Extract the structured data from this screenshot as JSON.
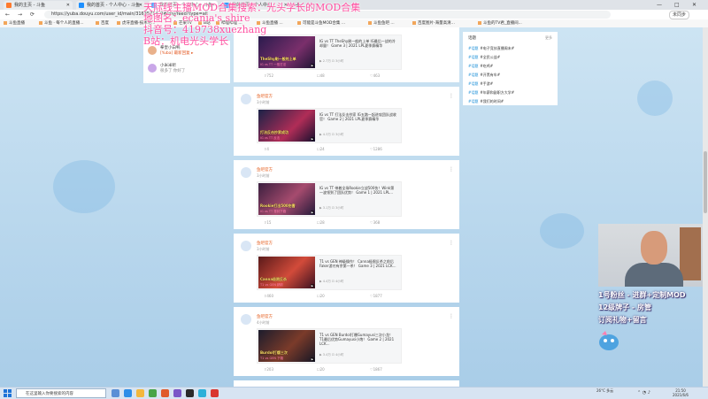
{
  "tabs": [
    {
      "label": "我的主页 - 斗鱼",
      "color": "#ff7a2e",
      "active": false
    },
    {
      "label": "我的首页 - 个人中心 - 斗鱼",
      "color": "#1e90ff",
      "active": false
    },
    {
      "label": "我的首页 - 个人中心 - 斗鱼",
      "color": "#1e90ff",
      "active": true
    },
    {
      "label": "我的首页 - 个人中心",
      "color": "#1e90ff",
      "active": false
    }
  ],
  "new_tab": "+",
  "window_controls": {
    "minimize": "—",
    "maximize": "□",
    "close": "✕"
  },
  "address": {
    "back": "←",
    "forward": "→",
    "refresh": "⟳",
    "url": "https://yuba.douyu.com/user_id/main/31635714_0#/my/feed?type=all",
    "profile_label": "未同步"
  },
  "bookmarks": [
    "斗鱼直播",
    "斗鱼 · 每个人的直播...",
    "百度",
    "虎牙直播-技术宅...",
    "芒果TV",
    "B站",
    "哔哩哔哩 ...",
    "斗鱼直播 ...",
    "可能是斗鱼MOD合集 ...",
    "斗鱼鱼吧 ...",
    "百度图片-海量高清...",
    "斗鱼的TV君_直播间..."
  ],
  "left_card": {
    "items": [
      {
        "name": "拳皇小白鸭",
        "sub": "[Yuba] 最新回复 ▸"
      },
      {
        "name": "小米米听",
        "sub": "很多了 你好了"
      }
    ]
  },
  "overlay": {
    "line1": "天际线主播MOD合集搜索：光头学长的MOD合集",
    "line2": "地图名：ecania's shire",
    "line3": "抖音号：419738xuezhang",
    "line4": "B站：机电光头学长"
  },
  "posts": [
    {
      "name": "",
      "time": "",
      "thumb_caption": "TheShy刷一般的上单",
      "thumb_caption2": "IG vs TT 一般打法",
      "title": "IG vs TT TheShy刷一般的上单 IG最后一战的冷却量！ Game 3 | 2021 LPL夏季赛精华",
      "stats": "▶ 2.7万  ⊡ 3小时",
      "likes": "752",
      "comments": "48",
      "shares": "463"
    },
    {
      "name": "鱼吧官方",
      "time": "3小时前",
      "thumb_caption": "打法反击抄家成功",
      "thumb_caption2": "IG vs TT 反击",
      "title": "IG vs TT 打法反击抄家 IG五路一起进攻团队战收官！ Game 2 | 2021 LPL夏季赛精华",
      "stats": "▶ 4.3万  ⊡ 3小时",
      "likes": "4",
      "comments": "24",
      "shares": "1286"
    },
    {
      "name": "鱼吧官方",
      "time": "3小时前",
      "thumb_caption": "Rookie打出500伤害",
      "thumb_caption2": "IG vs TT 零封下路",
      "title": "IG vs TT 带着全场Rookie立战500伤！Wink第一波领到了团队优势！ Game 1 | 2021 LPL...",
      "stats": "▶ 3.1万  ⊡ 3小时",
      "likes": "15",
      "comments": "28",
      "shares": "368"
    },
    {
      "name": "鱼吧官方",
      "time": "3小时前",
      "thumb_caption": "Canna极限反杀",
      "thumb_caption2": "T1 vs GEN 精彩",
      "title": "T1 vs GEN 神级操作！ Canna极限反杀之前后Faker游刃有余第一杀！ Game 3 | 2021 LCK...",
      "stats": "▶ 4.4万  ⊡ 4小时",
      "likes": "460",
      "comments": "20",
      "shares": "1877"
    },
    {
      "name": "鱼吧官方",
      "time": "4小时前",
      "thumb_caption": "Burdol打爆三次",
      "thumb_caption2": "T1 vs GEN 下路",
      "title": "T1 vs GEN Burdol打爆Gumayusi三次小龙！ T1最后优势Gumayusi小炮！ Game 2 | 2021 LCK...",
      "stats": "▶ 3.4万  ⊡ 4小时",
      "likes": "203",
      "comments": "20",
      "shares": "1867"
    }
  ],
  "right_card": {
    "title": "话题",
    "more": "更多",
    "items": [
      {
        "tag": "#话题",
        "text": "#电子竞技直播周末#"
      },
      {
        "tag": "#话题",
        "text": "#全民公益#"
      },
      {
        "tag": "#话题",
        "text": "#吃鸡#"
      },
      {
        "tag": "#话题",
        "text": "#开黑有车#"
      },
      {
        "tag": "#话题",
        "text": "#手游#"
      },
      {
        "tag": "#话题",
        "text": "#年薪和副职方大学#"
      },
      {
        "tag": "#话题",
        "text": "#我们的时间#"
      }
    ]
  },
  "stream_overlay": {
    "line1": "1号粉丝 - 进群+定制MOD",
    "line2": "12级牌子 - 房管",
    "line3": "订阅礼物+留言"
  },
  "taskbar": {
    "search_placeholder": "在这里输入你要搜索的内容",
    "weather": "26°C  多云",
    "time": "21:50",
    "date": "2021/6/6"
  },
  "colors": {
    "accent": "#ff7a2e",
    "topic_tag": "#1a8fd8",
    "overlay_pink": "#ff4fa0"
  }
}
